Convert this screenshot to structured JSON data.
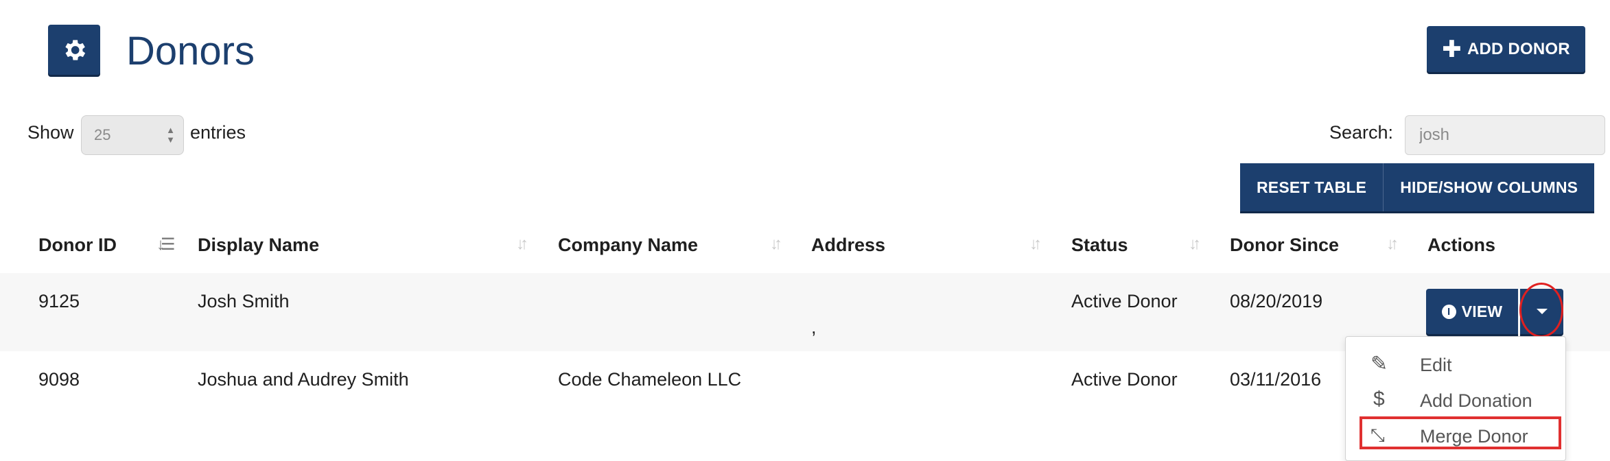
{
  "header": {
    "title": "Donors",
    "add_label": "ADD DONOR"
  },
  "controls": {
    "show_label": "Show",
    "page_length": "25",
    "entries_label": "entries",
    "search_label": "Search:",
    "search_value": "josh",
    "reset_label": "RESET TABLE",
    "hide_show_label": "HIDE/SHOW COLUMNS"
  },
  "table": {
    "columns": [
      "Donor ID",
      "Display Name",
      "Company Name",
      "Address",
      "Status",
      "Donor Since",
      "Actions"
    ],
    "rows": [
      {
        "id": "9125",
        "name": "Josh Smith",
        "company": "",
        "address": ",",
        "status": "Active Donor",
        "since": "08/20/2019"
      },
      {
        "id": "9098",
        "name": "Joshua and Audrey Smith",
        "company": "Code Chameleon LLC",
        "address": "",
        "status": "Active Donor",
        "since": "03/11/2016"
      }
    ],
    "view_label": "VIEW"
  },
  "dropdown": {
    "items": [
      {
        "label": "Edit",
        "icon": "pencil-icon"
      },
      {
        "label": "Add Donation",
        "icon": "dollar-icon"
      },
      {
        "label": "Merge Donor",
        "icon": "merge-arrows-icon"
      }
    ]
  },
  "colors": {
    "navy": "#1c3f6e",
    "highlight_red": "#e02020",
    "row_stripe": "#f7f7f7"
  }
}
